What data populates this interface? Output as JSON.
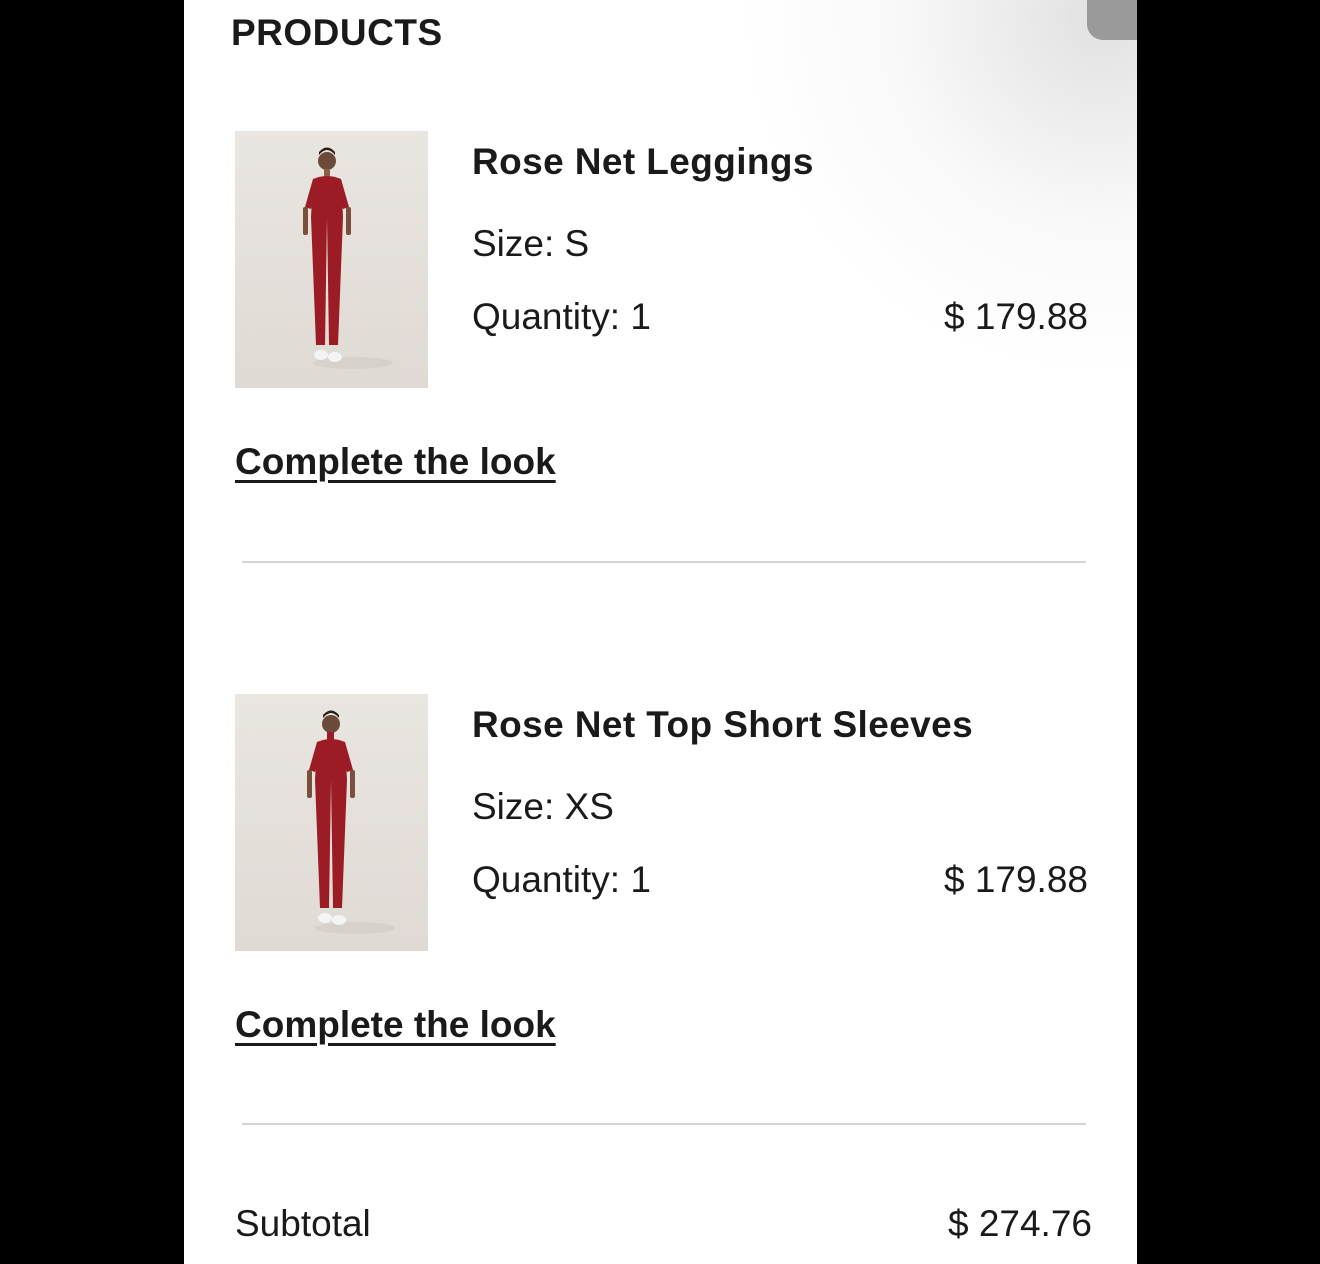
{
  "section": {
    "title": "PRODUCTS"
  },
  "products": [
    {
      "name": "Rose Net Leggings",
      "size": "Size: S",
      "quantity": "Quantity: 1",
      "price": "$ 179.88",
      "link": "Complete the look"
    },
    {
      "name": "Rose Net Top Short Sleeves",
      "size": "Size: XS",
      "quantity": "Quantity: 1",
      "price": "$ 179.88",
      "link": "Complete the look"
    }
  ],
  "summary": {
    "subtotal_label": "Subtotal",
    "subtotal_value": "$ 274.76"
  },
  "colors": {
    "garment": "#9b1c24",
    "text": "#1a1a1a",
    "divider": "#d4d4d4"
  }
}
